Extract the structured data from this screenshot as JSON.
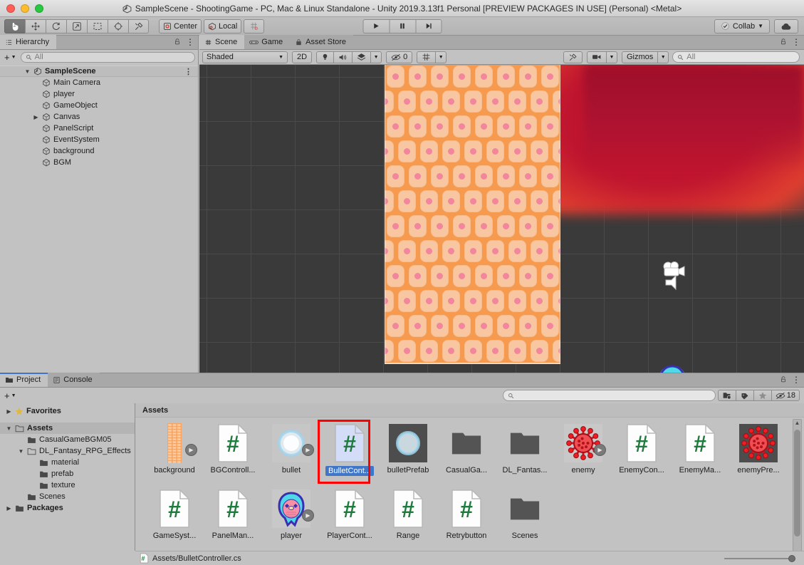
{
  "window": {
    "title": "SampleScene - ShootingGame - PC, Mac & Linux Standalone - Unity 2019.3.13f1 Personal [PREVIEW PACKAGES IN USE] (Personal) <Metal>"
  },
  "toolbar": {
    "tools": [
      {
        "name": "hand-tool",
        "glyph": "✋",
        "active": true
      },
      {
        "name": "move-tool",
        "glyph": "✥",
        "active": false
      },
      {
        "name": "rotate-tool",
        "glyph": "↺",
        "active": false
      },
      {
        "name": "scale-tool",
        "glyph": "↗",
        "active": false
      },
      {
        "name": "rect-tool",
        "glyph": "⬚",
        "active": false
      },
      {
        "name": "transform-tool",
        "glyph": "⊕",
        "active": false
      },
      {
        "name": "custom-tool",
        "glyph": "⚒",
        "active": false
      }
    ],
    "pivot_label": "Center",
    "space_label": "Local",
    "grid_label": "grid-snap",
    "play_label": "▶",
    "pause_label": "❙❙",
    "step_label": "▶❙",
    "collab_label": "Collab",
    "cloud_label": "cloud-icon"
  },
  "hierarchy": {
    "tab_label": "Hierarchy",
    "lock_icon": "lock-icon",
    "menu_icon": "kebab-icon",
    "add_label": "+",
    "search_placeholder": "All",
    "scene_name": "SampleScene",
    "objects": [
      {
        "label": "Main Camera",
        "expandable": false
      },
      {
        "label": "player",
        "expandable": false
      },
      {
        "label": "GameObject",
        "expandable": false
      },
      {
        "label": "Canvas",
        "expandable": true
      },
      {
        "label": "PanelScript",
        "expandable": false
      },
      {
        "label": "EventSystem",
        "expandable": false
      },
      {
        "label": "background",
        "expandable": false
      },
      {
        "label": "BGM",
        "expandable": false
      }
    ]
  },
  "scene_view": {
    "tabs": [
      {
        "label": "Scene",
        "icon": "grid-icon",
        "selected": true
      },
      {
        "label": "Game",
        "icon": "gamepad-icon",
        "selected": false
      },
      {
        "label": "Asset Store",
        "icon": "store-icon",
        "selected": false
      }
    ],
    "draw_mode": "Shaded",
    "mode_2d": "2D",
    "lighting_icon": "light-bulb-icon",
    "audio_icon": "speaker-icon",
    "fx_icon": "effects-icon",
    "hidden_count": "0",
    "grid_icon": "grid-visibility-icon",
    "tools_icon": "scene-tools-icon",
    "camera_icon": "scene-camera-icon",
    "gizmos_label": "Gizmos",
    "gizmo_search_placeholder": "All"
  },
  "project": {
    "tabs": [
      {
        "label": "Project",
        "icon": "folder-icon",
        "selected": true
      },
      {
        "label": "Console",
        "icon": "console-icon",
        "selected": false
      }
    ],
    "lock_icon": "lock-icon",
    "menu_icon": "kebab-icon",
    "add_label": "+",
    "search_placeholder": "",
    "filter_buttons": [
      {
        "name": "search-by-type-icon",
        "label": ""
      },
      {
        "name": "search-by-label-icon",
        "label": ""
      },
      {
        "name": "favorites-star-icon",
        "label": ""
      },
      {
        "name": "hidden-packages-icon",
        "label": "18"
      }
    ],
    "tree": [
      {
        "label": "Favorites",
        "depth": 0,
        "arrow": "▶",
        "icon": "star-icon",
        "bold": true,
        "selected": false
      },
      {
        "label": "",
        "depth": 0,
        "arrow": "",
        "icon": "spacer",
        "bold": false,
        "selected": false
      },
      {
        "label": "Assets",
        "depth": 0,
        "arrow": "▼",
        "icon": "open-folder-icon",
        "bold": true,
        "selected": true
      },
      {
        "label": "CasualGameBGM05",
        "depth": 1,
        "arrow": "",
        "icon": "folder-icon",
        "bold": false,
        "selected": false
      },
      {
        "label": "DL_Fantasy_RPG_Effects",
        "depth": 1,
        "arrow": "▼",
        "icon": "open-folder-icon",
        "bold": false,
        "selected": false
      },
      {
        "label": "material",
        "depth": 2,
        "arrow": "",
        "icon": "folder-icon",
        "bold": false,
        "selected": false
      },
      {
        "label": "prefab",
        "depth": 2,
        "arrow": "",
        "icon": "folder-icon",
        "bold": false,
        "selected": false
      },
      {
        "label": "texture",
        "depth": 2,
        "arrow": "",
        "icon": "folder-icon",
        "bold": false,
        "selected": false
      },
      {
        "label": "Scenes",
        "depth": 1,
        "arrow": "",
        "icon": "folder-icon",
        "bold": false,
        "selected": false
      },
      {
        "label": "Packages",
        "depth": 0,
        "arrow": "▶",
        "icon": "folder-icon",
        "bold": true,
        "selected": false
      }
    ],
    "breadcrumb": "Assets",
    "assets": [
      {
        "label": "background",
        "type": "texture-strip",
        "preview_play": true,
        "selected": false
      },
      {
        "label": "BGControll...",
        "type": "csharp",
        "preview_play": false,
        "selected": false
      },
      {
        "label": "bullet",
        "type": "sprite-bullet",
        "preview_play": true,
        "selected": false
      },
      {
        "label": "BulletCont...",
        "type": "csharp-selected",
        "preview_play": false,
        "selected": true
      },
      {
        "label": "bulletPrefab",
        "type": "prefab-bullet",
        "preview_play": false,
        "selected": false
      },
      {
        "label": "CasualGa...",
        "type": "folder",
        "preview_play": false,
        "selected": false
      },
      {
        "label": "DL_Fantas...",
        "type": "folder",
        "preview_play": false,
        "selected": false
      },
      {
        "label": "enemy",
        "type": "sprite-enemy",
        "preview_play": true,
        "selected": false
      },
      {
        "label": "EnemyCon...",
        "type": "csharp",
        "preview_play": false,
        "selected": false
      },
      {
        "label": "EnemyMa...",
        "type": "csharp",
        "preview_play": false,
        "selected": false
      },
      {
        "label": "enemyPre...",
        "type": "prefab-enemy",
        "preview_play": false,
        "selected": false
      },
      {
        "label": "GameSyst...",
        "type": "csharp",
        "preview_play": false,
        "selected": false
      },
      {
        "label": "PanelMan...",
        "type": "csharp",
        "preview_play": false,
        "selected": false
      },
      {
        "label": "player",
        "type": "sprite-player",
        "preview_play": true,
        "selected": false
      },
      {
        "label": "PlayerCont...",
        "type": "csharp",
        "preview_play": false,
        "selected": false
      },
      {
        "label": "Range",
        "type": "csharp",
        "preview_play": false,
        "selected": false
      },
      {
        "label": "Retrybutton",
        "type": "csharp",
        "preview_play": false,
        "selected": false
      },
      {
        "label": "Scenes",
        "type": "folder",
        "preview_play": false,
        "selected": false
      }
    ],
    "status_path": "Assets/BulletController.cs",
    "status_icon": "csharp-icon"
  },
  "colors": {
    "selection_blue": "#4076c8",
    "highlight_red": "#ff0000",
    "csharp_green": "#1f7a3d",
    "panel_gray": "#c2c2c2"
  }
}
